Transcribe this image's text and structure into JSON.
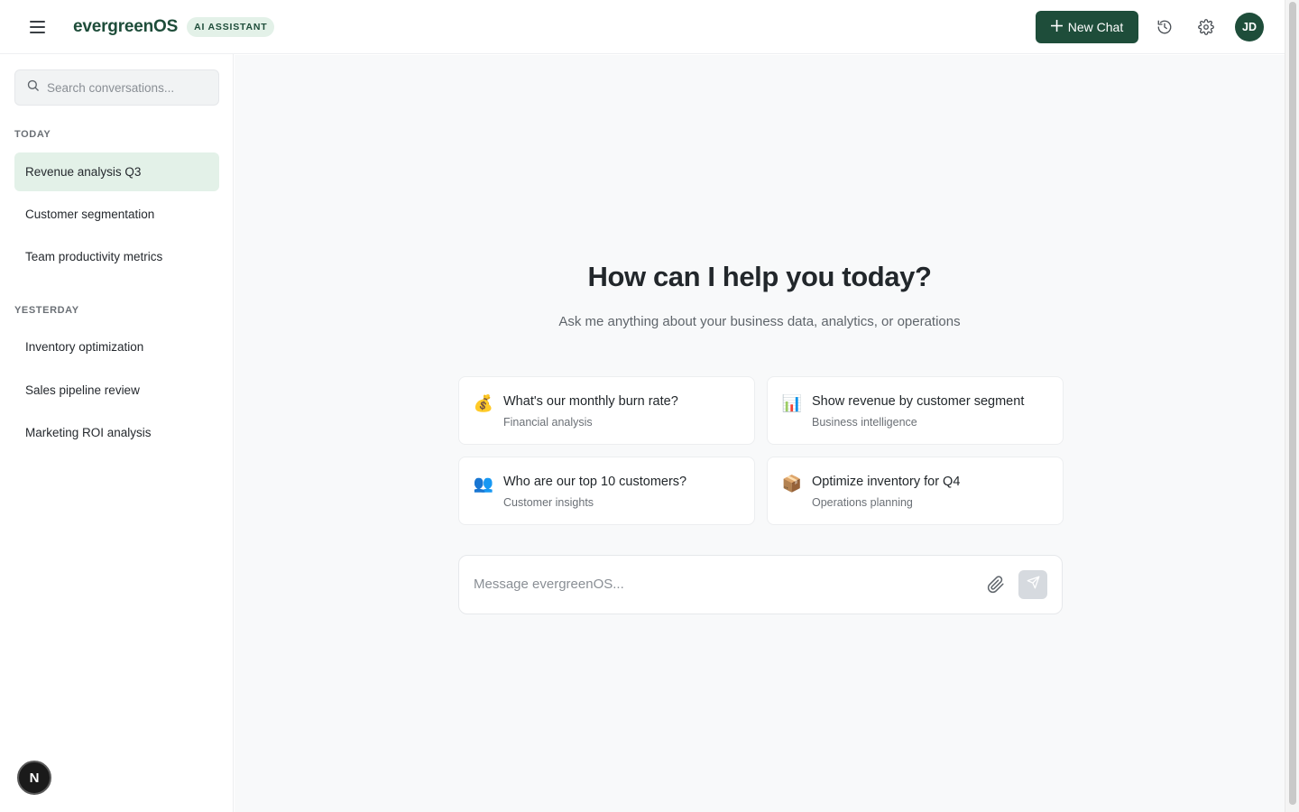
{
  "header": {
    "brand": "evergreenOS",
    "badge": "AI ASSISTANT",
    "new_chat_label": "New Chat",
    "avatar_initials": "JD",
    "icons": [
      "menu-icon",
      "plus-icon",
      "history-icon",
      "settings-icon"
    ]
  },
  "sidebar": {
    "search_placeholder": "Search conversations...",
    "groups": [
      {
        "label": "TODAY",
        "items": [
          "Revenue analysis Q3",
          "Customer segmentation",
          "Team productivity metrics"
        ]
      },
      {
        "label": "YESTERDAY",
        "items": [
          "Inventory optimization",
          "Sales pipeline review",
          "Marketing ROI analysis"
        ]
      }
    ],
    "active_item": "Revenue analysis Q3",
    "floating_button": "N"
  },
  "main": {
    "headline": "How can I help you today?",
    "subline": "Ask me anything about your business data, analytics, or operations",
    "suggestions": [
      {
        "emoji": "💰",
        "title": "What's our monthly burn rate?",
        "subtitle": "Financial analysis"
      },
      {
        "emoji": "📊",
        "title": "Show revenue by customer segment",
        "subtitle": "Business intelligence"
      },
      {
        "emoji": "👥",
        "title": "Who are our top 10 customers?",
        "subtitle": "Customer insights"
      },
      {
        "emoji": "📦",
        "title": "Optimize inventory for Q4",
        "subtitle": "Operations planning"
      }
    ],
    "composer_placeholder": "Message evergreenOS..."
  },
  "colors": {
    "brand": "#1e4d3a",
    "active_bg": "#e3f1e8",
    "main_bg": "#f8f9fa"
  }
}
